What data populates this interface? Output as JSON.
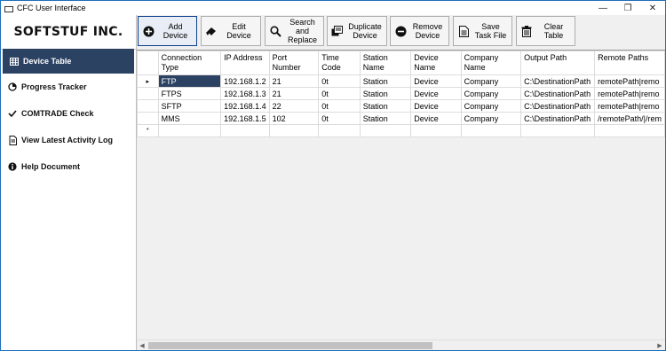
{
  "window": {
    "title": "CFC User Interface",
    "controls": {
      "minimize": "—",
      "restore": "❐",
      "close": "✕"
    }
  },
  "brand": {
    "logo": "SOFTSTUF INC."
  },
  "sidebar": {
    "items": [
      {
        "label": "Device Table",
        "icon": "table-icon",
        "active": true
      },
      {
        "label": "Progress Tracker",
        "icon": "pie-chart-icon",
        "active": false
      },
      {
        "label": "COMTRADE Check",
        "icon": "checkmark-icon",
        "active": false
      },
      {
        "label": "View Latest Activity Log",
        "icon": "document-icon",
        "active": false
      },
      {
        "label": "Help Document",
        "icon": "info-icon",
        "active": false
      }
    ]
  },
  "toolbar": {
    "buttons": [
      {
        "label": "Add Device",
        "icon": "plus-circle-icon"
      },
      {
        "label": "Edit Device",
        "icon": "eraser-icon"
      },
      {
        "label": "Search and Replace",
        "icon": "search-icon"
      },
      {
        "label": "Duplicate Device",
        "icon": "duplicate-icon"
      },
      {
        "label": "Remove Device",
        "icon": "minus-circle-icon"
      },
      {
        "label": "Save Task File",
        "icon": "save-file-icon"
      },
      {
        "label": "Clear Table",
        "icon": "trash-icon"
      }
    ]
  },
  "table": {
    "columns": [
      "Connection Type",
      "IP Address",
      "Port Number",
      "Time Code",
      "Station Name",
      "Device Name",
      "Company Name",
      "Output Path",
      "Remote Paths"
    ],
    "rows": [
      [
        "FTP",
        "192.168.1.2",
        "21",
        "0t",
        "Station",
        "Device",
        "Company",
        "C:\\DestinationPath",
        "remotePath|remo"
      ],
      [
        "FTPS",
        "192.168.1.3",
        "21",
        "0t",
        "Station",
        "Device",
        "Company",
        "C:\\DestinationPath",
        "remotePath|remo"
      ],
      [
        "SFTP",
        "192.168.1.4",
        "22",
        "0t",
        "Station",
        "Device",
        "Company",
        "C:\\DestinationPath",
        "remotePath|remo"
      ],
      [
        "MMS",
        "192.168.1.5",
        "102",
        "0t",
        "Station",
        "Device",
        "Company",
        "C:\\DestinationPath",
        "/remotePath/|/rem"
      ]
    ],
    "current_row_marker": "▸",
    "new_row_marker": "*"
  },
  "colors": {
    "accent": "#2b4263",
    "border": "#1e6fb8"
  }
}
